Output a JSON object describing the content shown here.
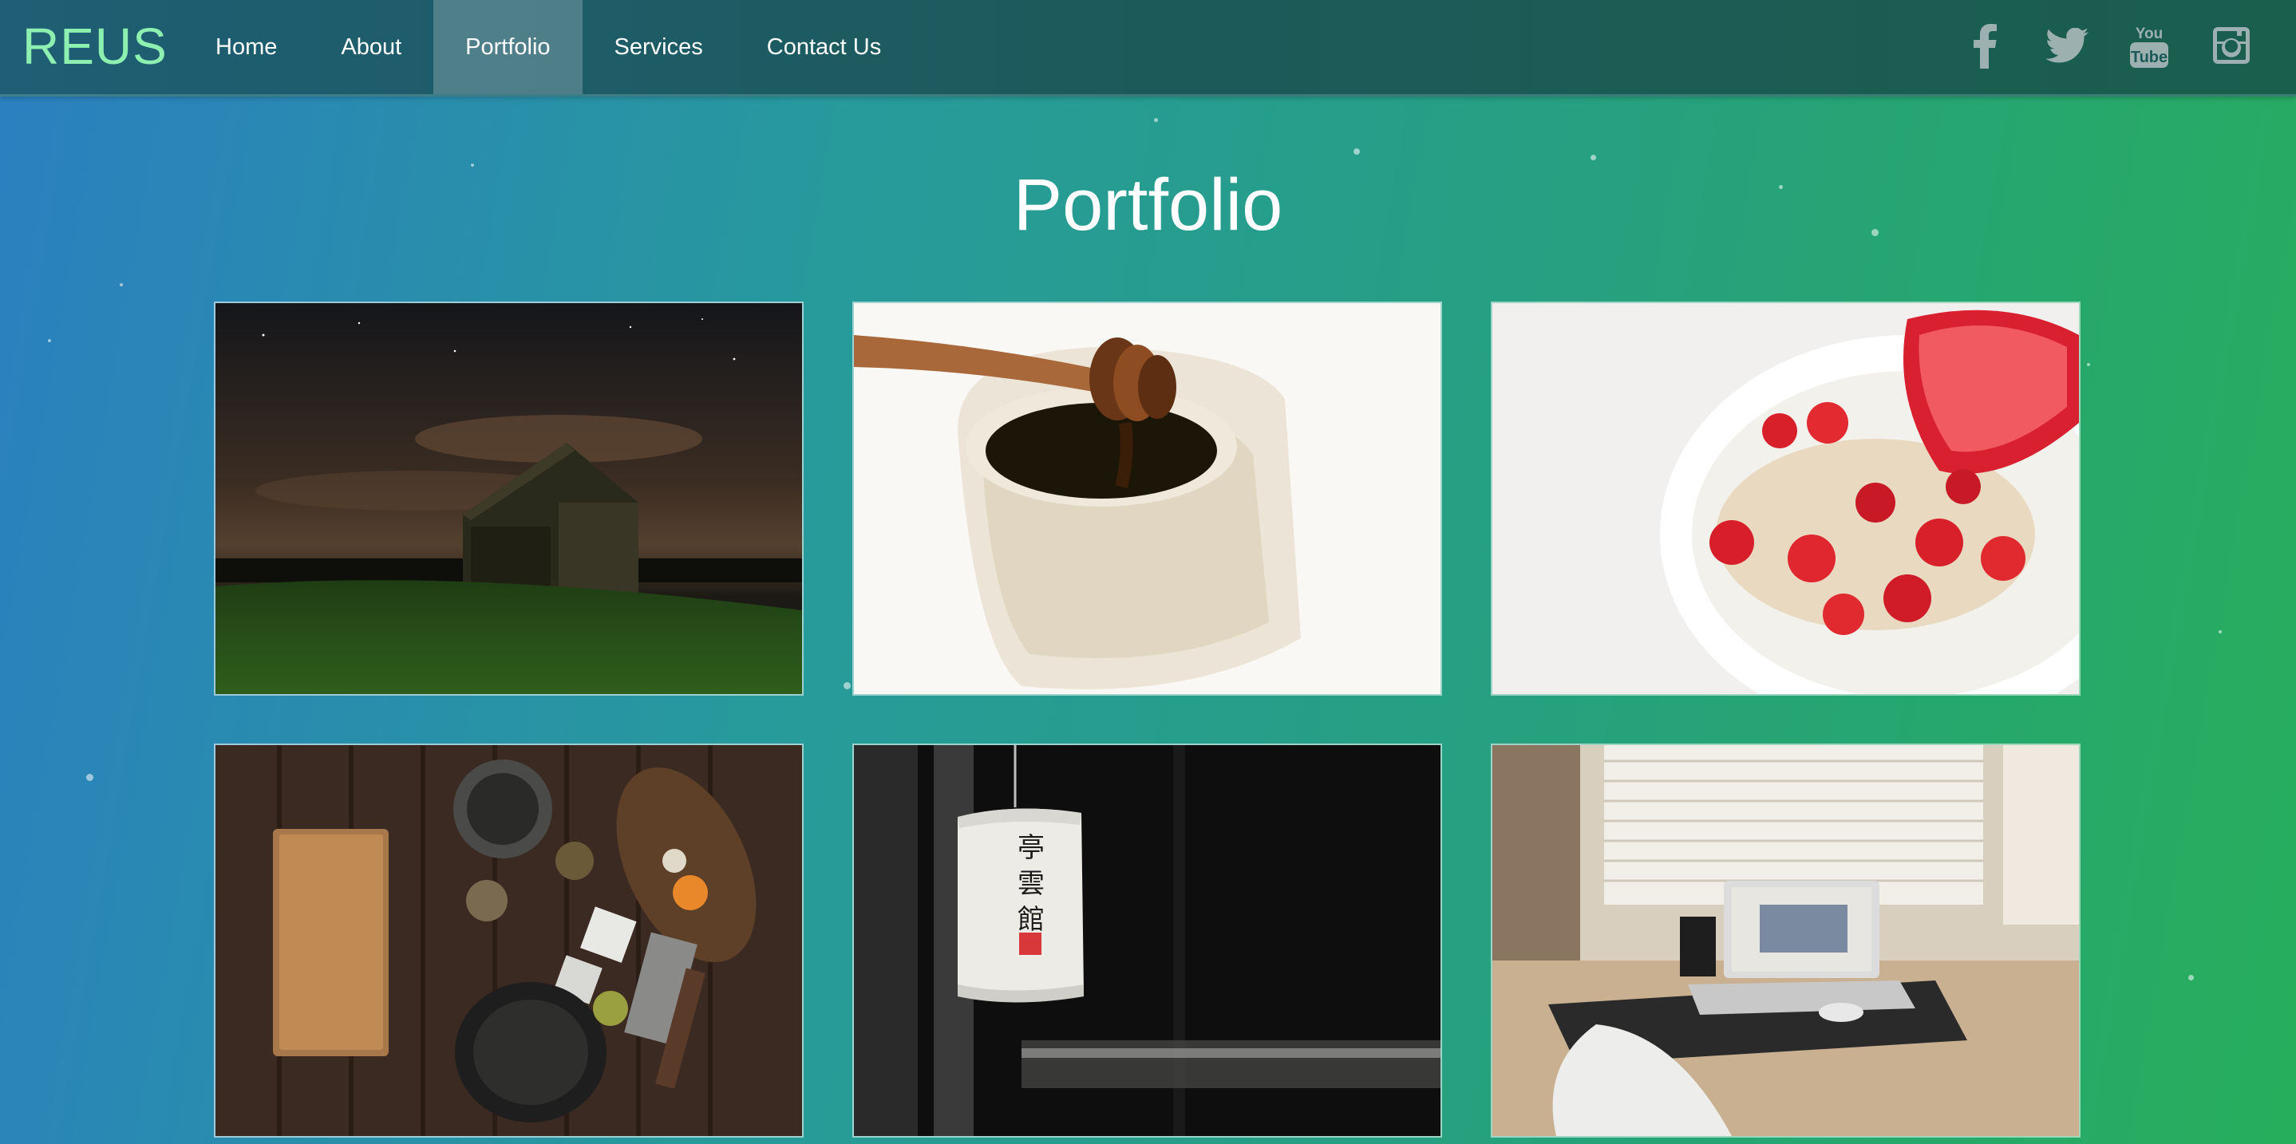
{
  "brand": "REUS",
  "nav": {
    "items": [
      "Home",
      "About",
      "Portfolio",
      "Services",
      "Contact Us"
    ],
    "active": "Portfolio"
  },
  "social": [
    "facebook-icon",
    "twitter-icon",
    "youtube-icon",
    "instagram-icon"
  ],
  "portfolio": {
    "title": "Portfolio",
    "items": [
      {
        "subject": "barn-at-night"
      },
      {
        "subject": "honey-dipper-jar"
      },
      {
        "subject": "strawberry-yogurt-bowl"
      },
      {
        "subject": "kitchen-utensils-spices"
      },
      {
        "subject": "paper-lantern"
      },
      {
        "subject": "laptop-desk-window"
      }
    ]
  },
  "colors": {
    "brand": "#8ef0b0",
    "nav_bg": "#1c5a5a",
    "gradient_start": "#2b7fc0",
    "gradient_end": "#27ae5c"
  }
}
